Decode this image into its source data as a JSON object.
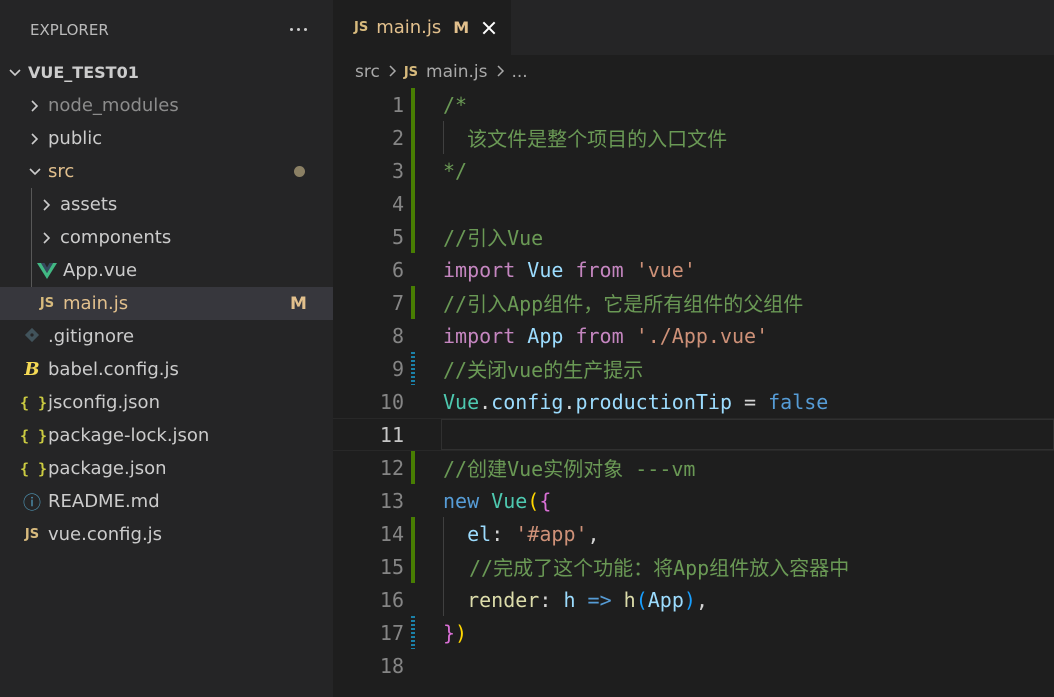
{
  "sidebar": {
    "title": "EXPLORER",
    "project": "VUE_TEST01",
    "items": [
      {
        "label": "node_modules",
        "kind": "folder"
      },
      {
        "label": "public",
        "kind": "folder"
      },
      {
        "label": "src",
        "kind": "folder-open"
      },
      {
        "label": "assets",
        "kind": "folder"
      },
      {
        "label": "components",
        "kind": "folder"
      },
      {
        "label": "App.vue",
        "kind": "vue"
      },
      {
        "label": "main.js",
        "kind": "js",
        "badge": "M"
      },
      {
        "label": ".gitignore",
        "kind": "git"
      },
      {
        "label": "babel.config.js",
        "kind": "babel"
      },
      {
        "label": "jsconfig.json",
        "kind": "json"
      },
      {
        "label": "package-lock.json",
        "kind": "json"
      },
      {
        "label": "package.json",
        "kind": "json"
      },
      {
        "label": "README.md",
        "kind": "info"
      },
      {
        "label": "vue.config.js",
        "kind": "js"
      }
    ]
  },
  "icons": {
    "js": "JS",
    "json": "{ }",
    "info": "ⓘ",
    "babel": "B"
  },
  "tab": {
    "label": "main.js",
    "badge": "M"
  },
  "breadcrumb": {
    "folder": "src",
    "file": "main.js",
    "trail": "..."
  },
  "editor": {
    "line_numbers": [
      "1",
      "2",
      "3",
      "4",
      "5",
      "6",
      "7",
      "8",
      "9",
      "10",
      "11",
      "12",
      "13",
      "14",
      "15",
      "16",
      "17",
      "18"
    ],
    "current_line": "11",
    "lines": {
      "l1": "/*",
      "l2": "  该文件是整个项目的入口文件",
      "l3": "*/",
      "l5": "//引入Vue",
      "l6_import": "import",
      "l6_vue": "Vue",
      "l6_from": "from",
      "l6_str": "'vue'",
      "l7": "//引入App组件，它是所有组件的父组件",
      "l8_import": "import",
      "l8_app": "App",
      "l8_from": "from",
      "l8_str": "'./App.vue'",
      "l9": "//关闭vue的生产提示",
      "l10_vue": "Vue",
      "l10_config": "config",
      "l10_prop": "productionTip",
      "l10_eq": " = ",
      "l10_false": "false",
      "l12": "//创建Vue实例对象 ---vm",
      "l13_new": "new",
      "l13_vue": "Vue",
      "l14_key": "el",
      "l14_str": "'#app'",
      "l15": "//完成了这个功能：将App组件放入容器中",
      "l16_render": "render",
      "l16_h": "h",
      "l16_arrow": "=>",
      "l16_call": "h",
      "l16_app": "App"
    }
  },
  "colors": {
    "git_added": "#487e02",
    "git_modified": "#1b81a8",
    "modified_text": "#e2c08d"
  }
}
